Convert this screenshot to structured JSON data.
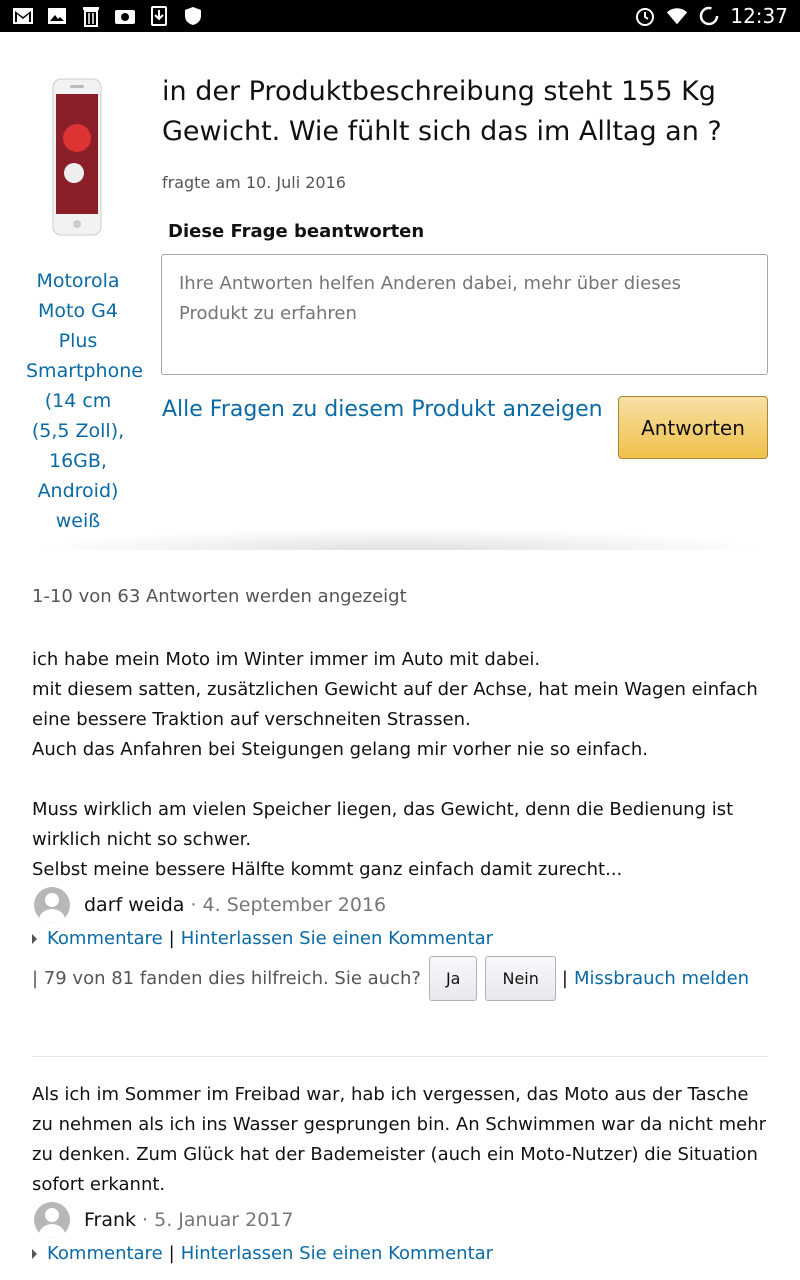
{
  "status_bar": {
    "time": "12:37",
    "left_icons": [
      "gmail-icon",
      "photo-icon",
      "trash-icon",
      "radio-icon",
      "download-icon",
      "shield-icon"
    ],
    "right_icons": [
      "alarm-icon",
      "wifi-icon",
      "sync-icon"
    ]
  },
  "product": {
    "name": "Motorola Moto G4 Plus Smartphone (14 cm (5,5 Zoll), 16GB, Android) weiß"
  },
  "question": {
    "text": "in der Produktbeschreibung steht 155 Kg Gewicht. Wie fühlt sich das im Alltag an ?",
    "asked": "fragte am 10. Juli 2016"
  },
  "answer_form": {
    "heading": "Diese Frage beantworten",
    "placeholder": "Ihre Antworten helfen Anderen dabei, mehr über dieses Produkt zu erfahren",
    "all_questions_link": "Alle Fragen zu diesem Produkt anzeigen",
    "submit_label": "Antworten"
  },
  "answers_count": "1-10 von 63 Antworten werden angezeigt",
  "answers": [
    {
      "paragraphs": [
        "ich habe mein Moto im Winter immer im Auto mit dabei.",
        "mit diesem satten, zusätzlichen Gewicht auf der Achse, hat mein Wagen einfach eine bessere Traktion auf verschneiten Strassen.",
        "Auch das Anfahren bei Steigungen gelang mir vorher nie so einfach.",
        "",
        "Muss wirklich am vielen Speicher liegen, das Gewicht, denn die Bedienung ist wirklich nicht so schwer.",
        "Selbst meine bessere Hälfte kommt ganz einfach damit zurecht..."
      ],
      "author": "darf weida",
      "date": "· 4. September 2016",
      "comments_label": "Kommentare",
      "leave_comment": "Hinterlassen Sie einen Kommentar",
      "helpful_text": "| 79 von 81 fanden dies hilfreich. Sie auch?",
      "yes_label": "Ja",
      "no_label": "Nein",
      "report_label": "Missbrauch melden"
    },
    {
      "paragraphs": [
        "Als ich im Sommer im Freibad war, hab ich vergessen, das Moto aus der Tasche zu nehmen als ich ins Wasser gesprungen bin. An Schwimmen war da nicht mehr zu denken. Zum Glück hat der Bademeister (auch ein Moto-Nutzer) die Situation sofort erkannt."
      ],
      "author": "Frank",
      "date": "· 5. Januar 2017",
      "comments_label": "Kommentare",
      "leave_comment": "Hinterlassen Sie einen Kommentar"
    }
  ],
  "colors": {
    "link": "#0a6aa5",
    "button_primary": "#f0c14b",
    "status_bar": "#000000"
  }
}
